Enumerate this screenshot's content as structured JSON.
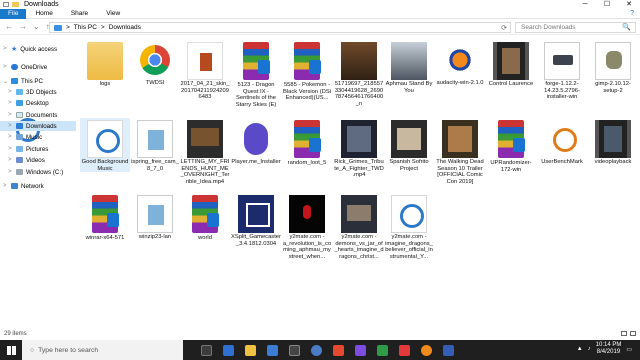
{
  "window": {
    "title": "Downloads",
    "help": "?"
  },
  "ribbon": {
    "file": "File",
    "tabs": [
      "Home",
      "Share",
      "View"
    ]
  },
  "nav": {
    "back": "←",
    "forward": "→",
    "dropdown": "⌄",
    "up": "↑"
  },
  "address": {
    "segments": [
      "This PC",
      "Downloads"
    ],
    "sep": ">",
    "refresh": "⟳"
  },
  "search": {
    "placeholder": "Search Downloads",
    "icon": "🔍"
  },
  "sidebar": {
    "items": [
      {
        "label": "Quick access",
        "icon": "star-icon",
        "chev": ">"
      },
      {
        "label": "OneDrive",
        "icon": "cloud-icon",
        "chev": ">"
      },
      {
        "label": "This PC",
        "icon": "pc-icon",
        "chev": "⌄"
      },
      {
        "label": "3D Objects",
        "icon": "cube-icon",
        "chev": ">"
      },
      {
        "label": "Desktop",
        "icon": "desktop-icon",
        "chev": ">"
      },
      {
        "label": "Documents",
        "icon": "documents-icon",
        "chev": ">"
      },
      {
        "label": "Downloads",
        "icon": "download-icon",
        "chev": ">"
      },
      {
        "label": "Music",
        "icon": "music-icon",
        "chev": ">"
      },
      {
        "label": "Pictures",
        "icon": "pictures-icon",
        "chev": ">"
      },
      {
        "label": "Videos",
        "icon": "videos-icon",
        "chev": ">"
      },
      {
        "label": "Windows (C:)",
        "icon": "drive-icon",
        "chev": ">"
      },
      {
        "label": "Network",
        "icon": "network-icon",
        "chev": ">"
      }
    ]
  },
  "files": [
    {
      "name": "logs",
      "kind": "folder"
    },
    {
      "name": "TWDSI",
      "kind": "chrome"
    },
    {
      "name": "2017_04_21_skin_2017042119242096483",
      "kind": "mario"
    },
    {
      "name": "5123 - Dragon Quest IX - Sentinels of the Starry Skies (E)",
      "kind": "winrar"
    },
    {
      "name": "5585 - Pokemon - Black Version (DSi Enhanced)(US...",
      "kind": "winrar"
    },
    {
      "name": "51719697_2185573304419628_2690787456461766400_n",
      "kind": "poster"
    },
    {
      "name": "Aphmau Stand By You",
      "kind": "vid1"
    },
    {
      "name": "audacity-win-2.1.0",
      "kind": "audacity"
    },
    {
      "name": "Control Laurence",
      "kind": "film"
    },
    {
      "name": "forge-1.12.2-14.23.5.2796-installer-win",
      "kind": "forge"
    },
    {
      "name": "gimp-2.10.12-setup-2",
      "kind": "gimp"
    },
    {
      "name": "Good Background Music",
      "kind": "goodbg"
    },
    {
      "name": "ispring_free_cam_8_7_0",
      "kind": "ispring"
    },
    {
      "name": "LETTING_MY_FRIENDS_HUNT_ME_OVERNIGHT_Terrible_Idea.mp4",
      "kind": "letting"
    },
    {
      "name": "Player.me_Installer",
      "kind": "playerme"
    },
    {
      "name": "random_loot_5",
      "kind": "winrar"
    },
    {
      "name": "Rick_Grimes_Tribute_A_Fighter_TWD.mp4",
      "kind": "rick"
    },
    {
      "name": "Spanish Sofrito Project",
      "kind": "spanish"
    },
    {
      "name": "The Walking Dead Season 10 Trailer [OFFICIAL Comic Con 2019]",
      "kind": "walking"
    },
    {
      "name": "UPRandomizer-172-win",
      "kind": "winrar"
    },
    {
      "name": "UserBenchMark",
      "kind": "userbench"
    },
    {
      "name": "videoplayback",
      "kind": "film"
    },
    {
      "name": "winrar-x64-571",
      "kind": "winrar"
    },
    {
      "name": "winzip23-lan",
      "kind": "ispring"
    },
    {
      "name": "world",
      "kind": "winrar"
    },
    {
      "name": "XSplit_Gamecaster_3.4.1812.0304",
      "kind": "xsplit"
    },
    {
      "name": "y2mate.com - a_revolution_is_coming_aphmau_mystreet_when...",
      "kind": "y1"
    },
    {
      "name": "y2mate.com - demons_vs_jar_of_hearts_imagine_dragons_christ...",
      "kind": "y2"
    },
    {
      "name": "y2mate.com - imagine_dragons_believer_official_instrumental_Y...",
      "kind": "doc"
    }
  ],
  "status": {
    "count": "29 items"
  },
  "taskbar": {
    "search_placeholder": "Type here to search",
    "time": "10:14 PM",
    "date": "8/4/2019"
  },
  "colors": {
    "accent": "#1979ca",
    "selection": "#cce4f7",
    "taskbar": "#1f1f1f"
  }
}
